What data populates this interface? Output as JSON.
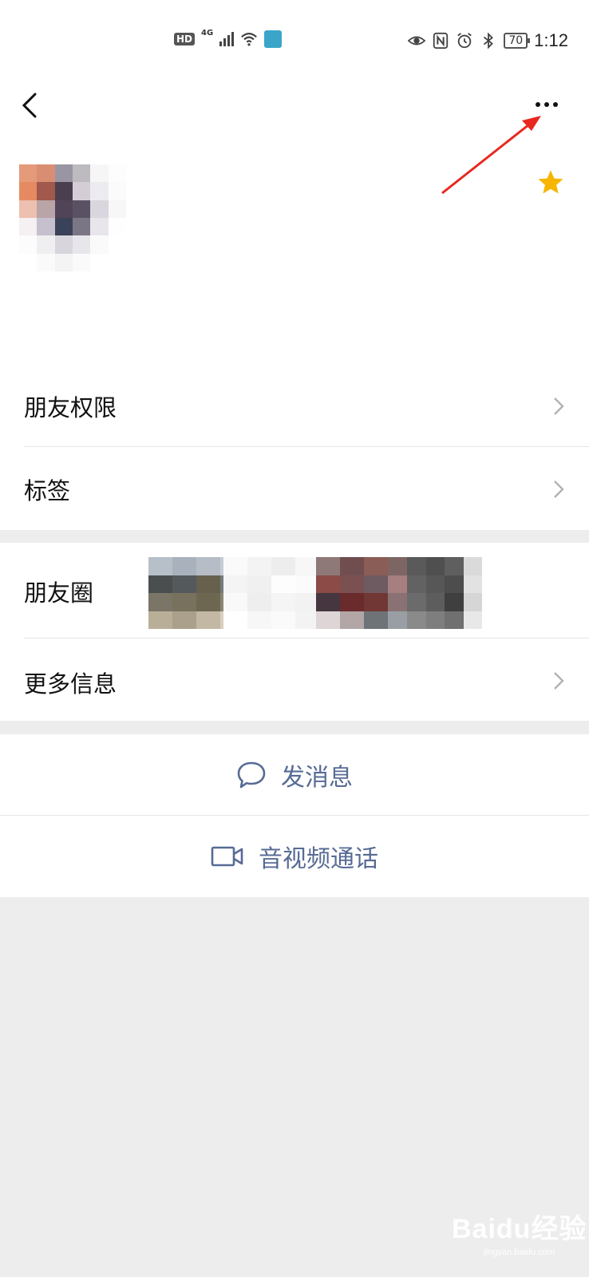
{
  "status_bar": {
    "hd": "HD",
    "network": "4G",
    "battery": "70",
    "time": "1:12"
  },
  "rows": {
    "friend_permissions": "朋友权限",
    "tags": "标签",
    "moments": "朋友圈",
    "more_info": "更多信息"
  },
  "actions": {
    "send_message": "发消息",
    "video_call": "音视频通话"
  },
  "colors": {
    "link_blue": "#576b95",
    "star_gold": "#f7b500",
    "annotation_red": "#e8281f",
    "page_bg": "#ededed"
  },
  "watermark": {
    "brand": "Baidu经验",
    "url": "jingyan.baidu.com"
  }
}
